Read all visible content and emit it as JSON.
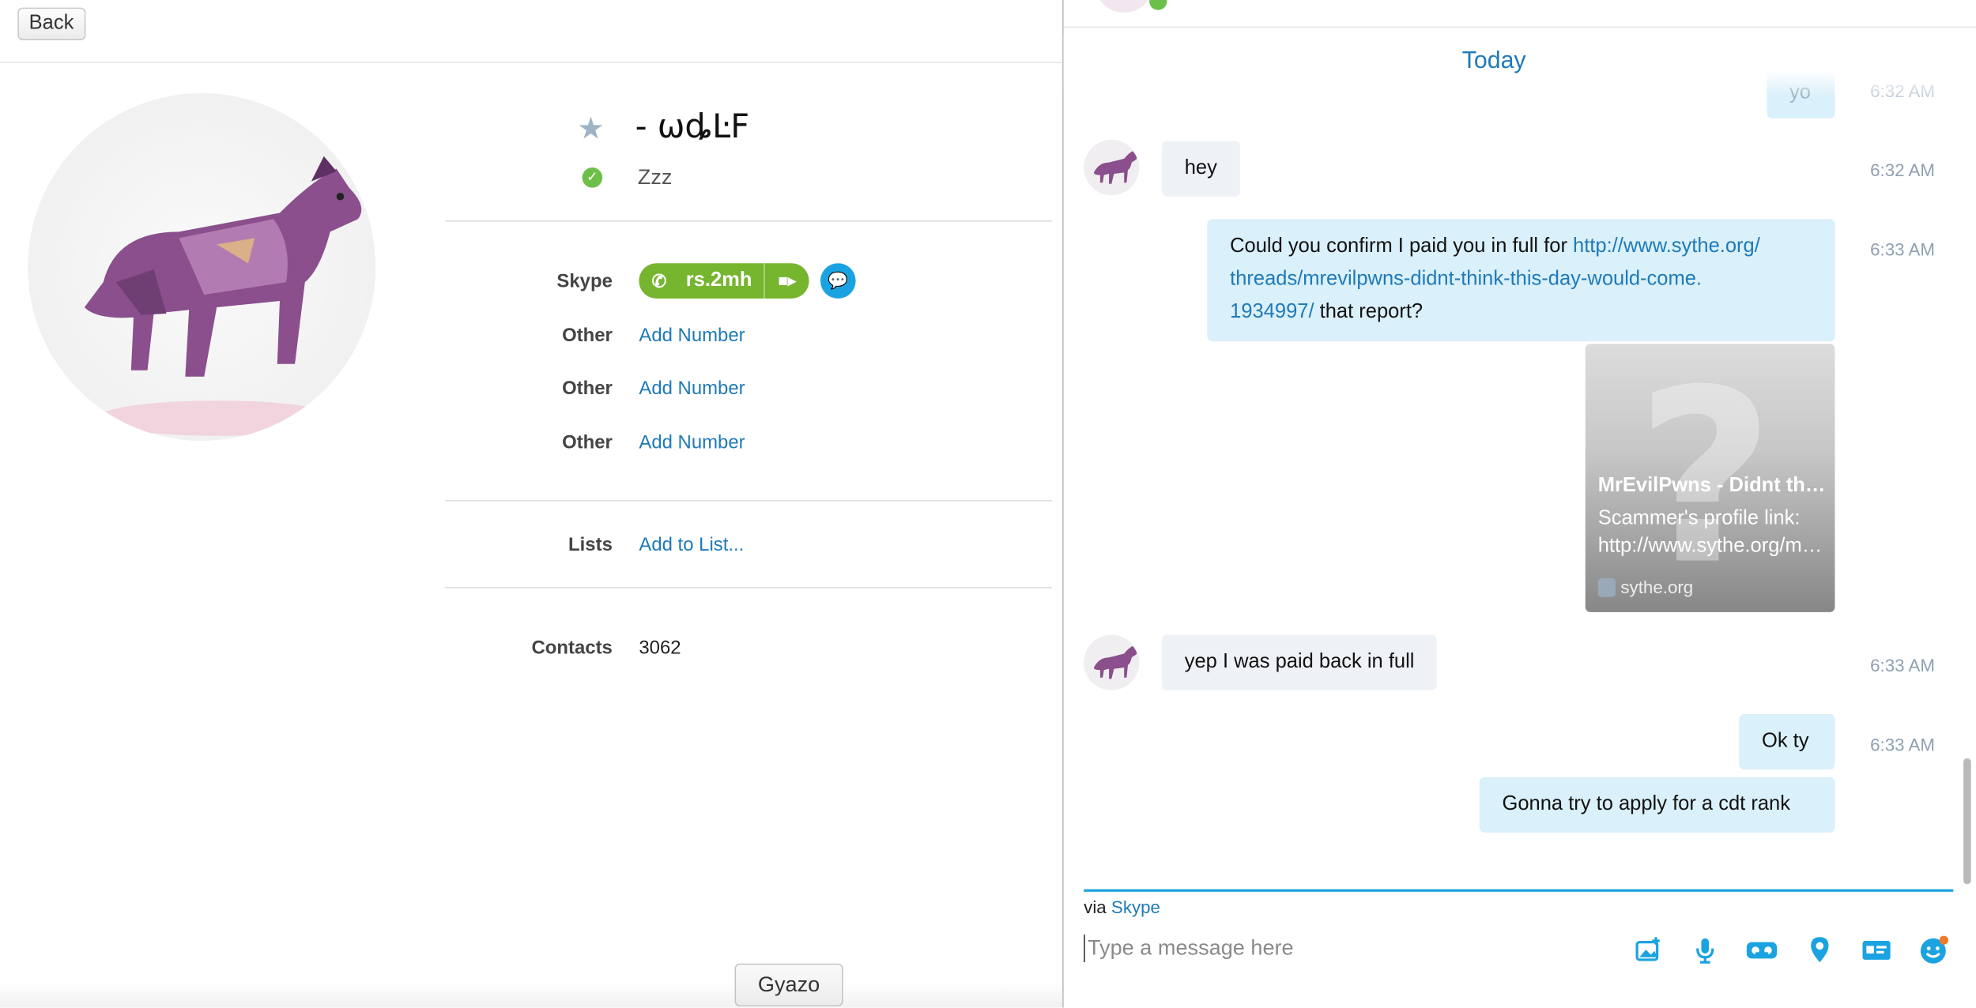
{
  "left": {
    "back_label": "Back",
    "display_name": "- ωȡĿF",
    "mood": "Zzz",
    "fields": {
      "skype_label": "Skype",
      "skype_id": "rs.2mh",
      "other1_label": "Other",
      "other1_link": "Add Number",
      "other2_label": "Other",
      "other2_link": "Add Number",
      "other3_label": "Other",
      "other3_link": "Add Number",
      "lists_label": "Lists",
      "lists_link": "Add to List...",
      "contacts_label": "Contacts",
      "contacts_value": "3062"
    },
    "gyazo_label": "Gyazo"
  },
  "chat": {
    "day_header": "Today",
    "partial_msg": "yo",
    "partial_ts": "6:32 AM",
    "messages": [
      {
        "text": "hey",
        "time": "6:32 AM"
      },
      {
        "text_pre": "Could you confirm I paid you in full for ",
        "link1": "http://www.sythe.org/",
        "link2": "threads/mrevilpwns-didnt-think-this-day-would-come.",
        "link3": "1934997/",
        "text_post": " that report?",
        "time": "6:33 AM"
      },
      {
        "text": "yep I was paid back in full",
        "time": "6:33 AM"
      },
      {
        "text": "Ok ty",
        "time": "6:33 AM"
      },
      {
        "text": "Gonna try to apply for a cdt rank"
      }
    ],
    "card": {
      "title": "MrEvilPwns - Didnt think this day would come",
      "desc1": "Scammer's profile link:",
      "desc2": "http://www.sythe.org/members/",
      "site": "sythe.org"
    },
    "via_prefix": "via",
    "via_link": "Skype",
    "compose_placeholder": "Type a message here",
    "accent": "#1aa3e0"
  }
}
